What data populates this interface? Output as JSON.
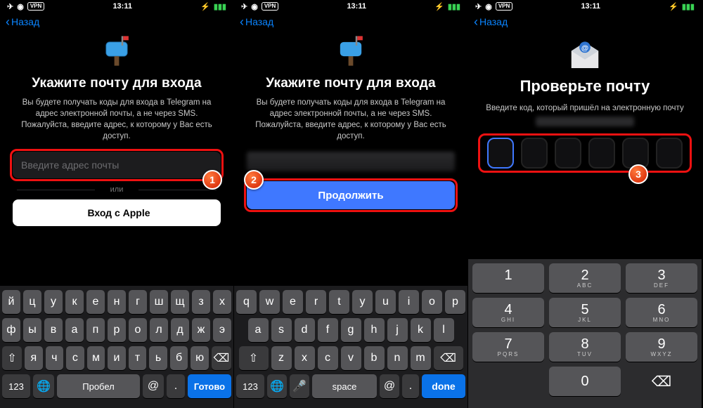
{
  "status": {
    "time": "13:11",
    "vpn": "VPN",
    "airplane": "✈",
    "wifi": "◉",
    "bolt": "⚡",
    "battery": "▮▮▮"
  },
  "nav": {
    "back": "Назад"
  },
  "screen1": {
    "title": "Укажите почту для входа",
    "desc": "Вы будете получать коды для входа в Telegram на адрес электронной почты, а не через SMS. Пожалуйста, введите адрес, к которому у Вас есть доступ.",
    "placeholder": "Введите адрес почты",
    "or": "или",
    "apple": "Вход с Apple",
    "step": "1"
  },
  "screen2": {
    "title": "Укажите почту для входа",
    "desc": "Вы будете получать коды для входа в Telegram на адрес электронной почты, а не через SMS. Пожалуйста, введите адрес, к которому у Вас есть доступ.",
    "continue": "Продолжить",
    "step": "2"
  },
  "screen3": {
    "title": "Проверьте почту",
    "desc": "Введите код, который пришёл на электронную почту",
    "step": "3"
  },
  "kbd_ru": {
    "row1": [
      "й",
      "ц",
      "у",
      "к",
      "е",
      "н",
      "г",
      "ш",
      "щ",
      "з",
      "х"
    ],
    "row2": [
      "ф",
      "ы",
      "в",
      "а",
      "п",
      "р",
      "о",
      "л",
      "д",
      "ж",
      "э"
    ],
    "row3": [
      "я",
      "ч",
      "с",
      "м",
      "и",
      "т",
      "ь",
      "б",
      "ю"
    ],
    "shift": "⇧",
    "del": "⌫",
    "n123": "123",
    "globe": "🌐",
    "space": "Пробел",
    "at": "@",
    "dot": ".",
    "done": "Готово"
  },
  "kbd_en": {
    "row1": [
      "q",
      "w",
      "e",
      "r",
      "t",
      "y",
      "u",
      "i",
      "o",
      "p"
    ],
    "row2": [
      "a",
      "s",
      "d",
      "f",
      "g",
      "h",
      "j",
      "k",
      "l"
    ],
    "row3": [
      "z",
      "x",
      "c",
      "v",
      "b",
      "n",
      "m"
    ],
    "shift": "⇧",
    "del": "⌫",
    "n123": "123",
    "globe": "🌐",
    "mic": "🎤",
    "space": "space",
    "at": "@",
    "dot": ".",
    "done": "done"
  },
  "numpad": {
    "keys": [
      {
        "d": "1",
        "l": ""
      },
      {
        "d": "2",
        "l": "ABC"
      },
      {
        "d": "3",
        "l": "DEF"
      },
      {
        "d": "4",
        "l": "GHI"
      },
      {
        "d": "5",
        "l": "JKL"
      },
      {
        "d": "6",
        "l": "MNO"
      },
      {
        "d": "7",
        "l": "PQRS"
      },
      {
        "d": "8",
        "l": "TUV"
      },
      {
        "d": "9",
        "l": "WXYZ"
      }
    ],
    "zero": "0",
    "del": "⌫"
  }
}
